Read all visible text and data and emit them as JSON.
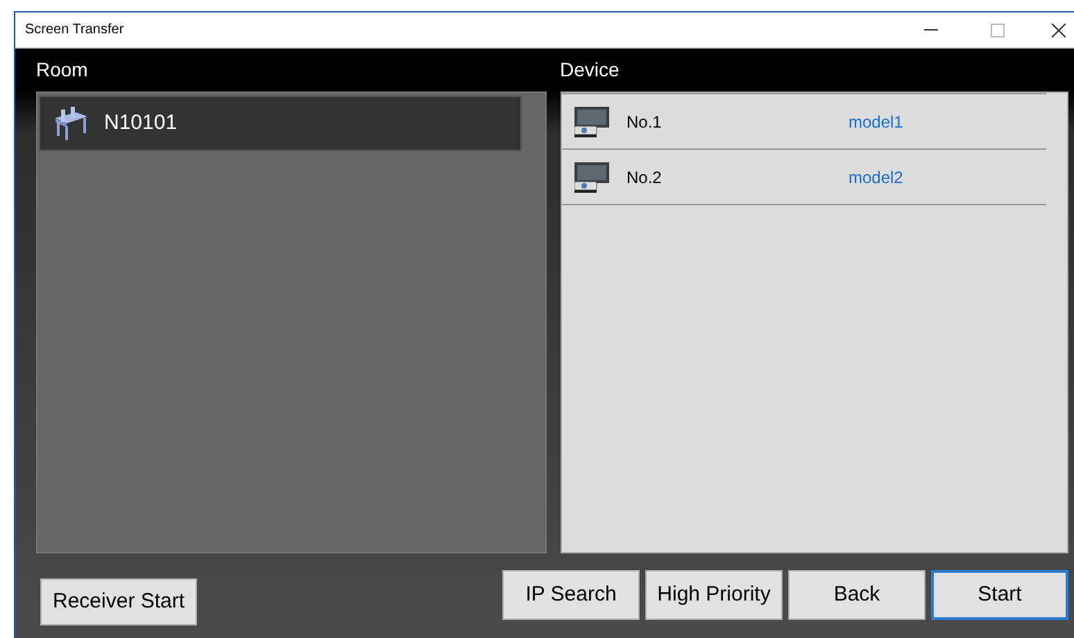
{
  "window": {
    "title": "Screen Transfer"
  },
  "room": {
    "heading": "Room",
    "items": [
      {
        "name": "N10101",
        "selected": true
      }
    ]
  },
  "device": {
    "heading": "Device",
    "items": [
      {
        "name": "No.1",
        "model": "model1"
      },
      {
        "name": "No.2",
        "model": "model2"
      }
    ]
  },
  "left_buttons": [
    {
      "label": "Receiver Start",
      "default": false
    }
  ],
  "right_buttons": [
    {
      "label": "IP Search",
      "default": false
    },
    {
      "label": "High Priority",
      "default": false
    },
    {
      "label": "Back",
      "default": false
    },
    {
      "label": "Start",
      "default": true
    }
  ]
}
